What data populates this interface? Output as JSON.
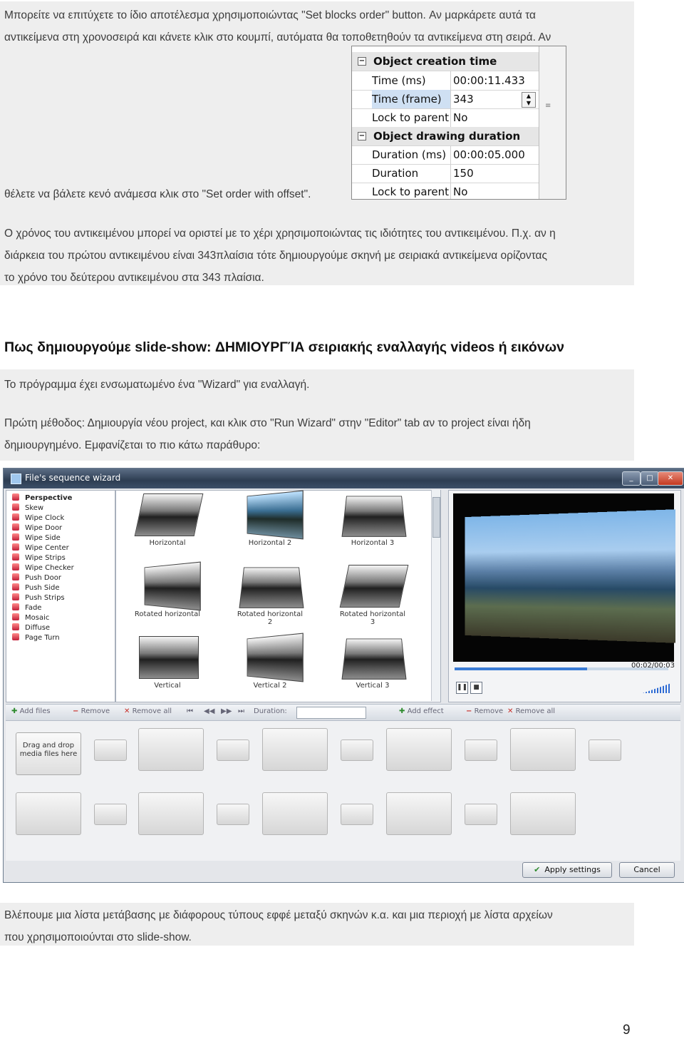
{
  "paragraphs": {
    "p1_line1": "Μπορείτε να επιτύχετε το ίδιο αποτέλεσμα χρησιμοποιώντας \"Set blocks order\" button. Αν μαρκάρετε αυτά τα",
    "p1_line2": "αντικείμενα στη χρονοσειρά και κάνετε κλικ στο κουμπί, αυτόματα θα τοποθετηθούν τα αντικείμενα στη σειρά. Αν",
    "p1_line3": "θέλετε να βάλετε κενό ανάμεσα κλικ στο \"Set order with offset\".",
    "p2_line1": "Ο χρόνος του αντικειμένου μπορεί να οριστεί με το χέρι χρησιμοποιώντας τις ιδιότητες του αντικειμένου. Π.χ. αν η",
    "p2_line2": "διάρκεια του πρώτου αντικειμένου είναι 343πλαίσια τότε δημιουργούμε σκηνή με σειριακά αντικείμενα ορίζοντας",
    "p2_line3": "το χρόνο του δεύτερου αντικειμένου στα 343 πλαίσια.",
    "heading": "Πως δημιουργούμε slide-show: ΔΗΜΙΟΥΡΓΊΑ σειριακής εναλλαγής videos ή εικόνων",
    "p3": "Το πρόγραμμα έχει ενσωματωμένο ένα \"Wizard\" για εναλλαγή.",
    "p4_line1": "Πρώτη μέθοδος: Δημιουργία νέου project, και κλικ στο \"Run Wizard\" στην \"Editor\" tab αν το project είναι ήδη",
    "p4_line2": "δημιουργημένο. Εμφανίζεται το πιο κάτω παράθυρο:",
    "p5_line1": "Βλέπουμε μια λίστα μετάβασης με διάφορους τύπους εφφέ μεταξύ σκηνών κ.α. και μια περιοχή με λίστα αρχείων",
    "p5_line2": "που χρησιμοποιούνται στο slide-show."
  },
  "property_grid": {
    "group1": "Object creation time",
    "group2": "Object drawing duration",
    "rows1": [
      {
        "label": "Time (ms)",
        "value": "00:00:11.433"
      },
      {
        "label": "Time (frame)",
        "value": "343"
      },
      {
        "label": "Lock to parent",
        "value": "No"
      }
    ],
    "rows2": [
      {
        "label": "Duration (ms)",
        "value": "00:00:05.000"
      },
      {
        "label": "Duration (fram",
        "value": "150"
      },
      {
        "label": "Lock to parent",
        "value": "No"
      }
    ]
  },
  "wizard": {
    "title": "File's sequence wizard",
    "effects": [
      "Perspective",
      "Skew",
      "Wipe Clock",
      "Wipe Door",
      "Wipe Side",
      "Wipe Center",
      "Wipe Strips",
      "Wipe Checker",
      "Push Door",
      "Push Side",
      "Push Strips",
      "Fade",
      "Mosaic",
      "Diffuse",
      "Page Turn"
    ],
    "thumbs": [
      "Horizontal",
      "Horizontal 2",
      "Horizontal 3",
      "Rotated horizontal",
      "Rotated horizontal 2",
      "Rotated horizontal 3",
      "Vertical",
      "Vertical 2",
      "Vertical 3"
    ],
    "timecode": "00:02/00:03",
    "progress": 0.62,
    "toolbar": {
      "add_files": "Add files",
      "remove": "Remove",
      "remove_all": "Remove all",
      "duration": "Duration:",
      "add_effect": "Add effect",
      "remove2": "Remove",
      "remove_all2": "Remove all"
    },
    "dropzone": "Drag and drop\nmedia files here",
    "apply": "Apply settings",
    "cancel": "Cancel"
  },
  "page_number": "9",
  "colors": {
    "band": "#eeeeee",
    "accent": "#3a7bd5"
  }
}
